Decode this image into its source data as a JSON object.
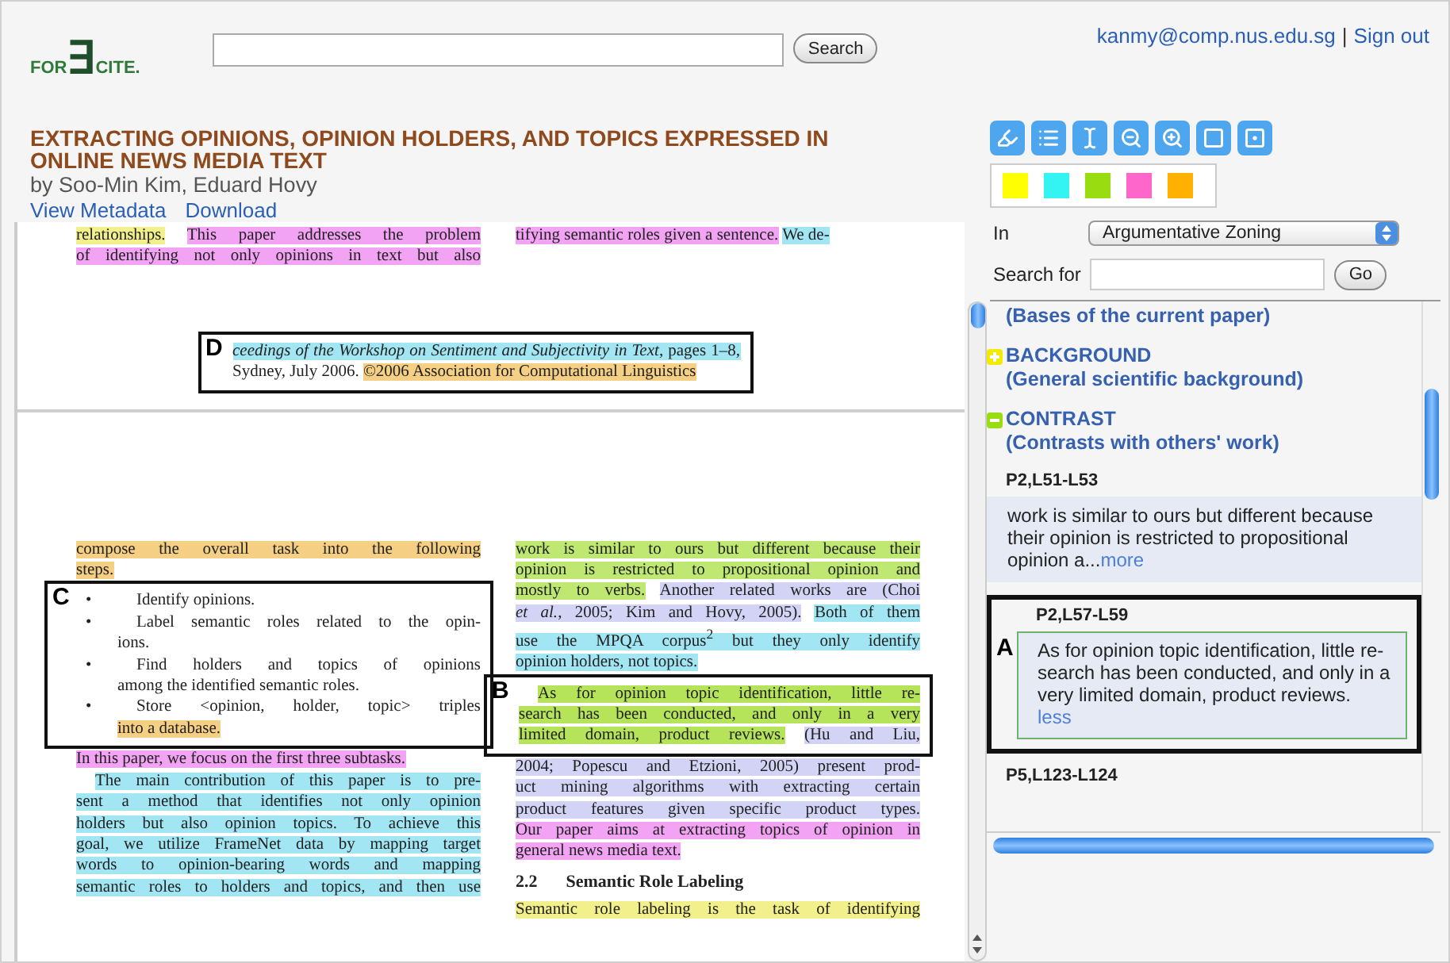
{
  "header": {
    "logo": [
      "FOR",
      "∃",
      "CITE."
    ],
    "search_button": "Search",
    "user": "kanmy@comp.nus.edu.sg",
    "separator": "|",
    "sign_out": "Sign out"
  },
  "paper": {
    "title": "EXTRACTING OPINIONS, OPINION HOLDERS, AND TOPICS EXPRESSED IN ONLINE NEWS MEDIA TEXT",
    "authors": "by Soo-Min Kim, Eduard Hovy",
    "links": [
      "View Metadata",
      "Download"
    ]
  },
  "document": {
    "page_1": {
      "left": [
        {
          "kind": "line",
          "segments": [
            {
              "text": "relationships.",
              "color": "#f2f08c"
            },
            {
              "text": "This paper addresses the problem",
              "color": "#f3a3f3"
            }
          ]
        },
        {
          "kind": "line",
          "segments": [
            {
              "text": "of identifying not only opinions in text but also",
              "color": "#f3a3f3"
            }
          ]
        }
      ],
      "right": [
        {
          "kind": "line",
          "end": true,
          "segments": [
            {
              "text": "tifying semantic roles given a sentence.",
              "color": "#f3a3f3"
            },
            {
              "text": "We de-",
              "color": "#a3e6f3"
            }
          ]
        }
      ],
      "footnote": {
        "label": "D",
        "lines": [
          {
            "segments": [
              {
                "text": "*ceedings of the Workshop on Sentiment and Subjectivity in Text*, pages 1–8,",
                "color": "#a3e6f3"
              }
            ]
          },
          {
            "end": true,
            "segments": [
              {
                "text": "Sydney, July 2006. "
              },
              {
                "text": "©2006 Association for Computational Linguistics",
                "color": "#f5cf83"
              }
            ]
          }
        ]
      }
    },
    "page_2": {
      "left": [
        {
          "kind": "line",
          "segments": [
            {
              "text": "compose the overall task into the following",
              "color": "#f5cf83"
            }
          ]
        },
        {
          "kind": "line",
          "segments": [
            {
              "text": "steps.",
              "color": "#f5cf83"
            }
          ]
        },
        {
          "kind": "callout",
          "label": "C",
          "blocks": [
            {
              "kind": "bullet",
              "bullet": "•",
              "lines": [
                {
                  "end": true,
                  "segments": [
                    {
                      "text": "Identify opinions."
                    }
                  ]
                }
              ]
            },
            {
              "kind": "bullet",
              "bullet": "•",
              "lines": [
                {
                  "segments": [
                    {
                      "text": "Label semantic roles related to the opin-"
                    }
                  ]
                },
                {
                  "segments": [
                    {
                      "text": "ions."
                    }
                  ]
                }
              ]
            },
            {
              "kind": "bullet",
              "bullet": "•",
              "lines": [
                {
                  "segments": [
                    {
                      "text": "Find holders and topics of opinions"
                    }
                  ]
                },
                {
                  "end": true,
                  "segments": [
                    {
                      "text": "among the identified semantic roles."
                    }
                  ]
                }
              ]
            },
            {
              "kind": "bullet",
              "bullet": "•",
              "lines": [
                {
                  "segments": [
                    {
                      "text": "Store <opinion, holder, topic> triples"
                    }
                  ]
                },
                {
                  "end": true,
                  "segments": [
                    {
                      "text": "into a database.",
                      "color": "#f5cf83"
                    }
                  ]
                }
              ]
            }
          ]
        },
        {
          "kind": "line",
          "end": true,
          "segments": [
            {
              "text": "In this paper, we focus on the first three subtasks.",
              "color": "#f3a3f3"
            }
          ]
        },
        {
          "kind": "line",
          "indent": true,
          "segments": [
            {
              "text": "The main contribution of this paper is to pre-",
              "color": "#a3e6f3"
            }
          ]
        },
        {
          "kind": "line",
          "segments": [
            {
              "text": "sent a method that identifies not only opinion",
              "color": "#a3e6f3"
            }
          ]
        },
        {
          "kind": "line",
          "segments": [
            {
              "text": "holders but also opinion topics. To achieve this",
              "color": "#a3e6f3"
            }
          ]
        },
        {
          "kind": "line",
          "segments": [
            {
              "text": "goal, we utilize FrameNet data by mapping target",
              "color": "#a3e6f3"
            }
          ]
        },
        {
          "kind": "line",
          "segments": [
            {
              "text": "words to opinion-bearing words and mapping",
              "color": "#a3e6f3"
            }
          ]
        },
        {
          "kind": "line",
          "segments": [
            {
              "text": "semantic roles to holders and topics, and then use",
              "color": "#a3e6f3"
            }
          ]
        }
      ],
      "right": [
        {
          "kind": "line",
          "segments": [
            {
              "text": "work is similar to ours but different because their",
              "color": "#bfe873"
            }
          ]
        },
        {
          "kind": "line",
          "segments": [
            {
              "text": "opinion is restricted to propositional opinion and",
              "color": "#bfe873"
            }
          ]
        },
        {
          "kind": "line",
          "segments": [
            {
              "text": "mostly to verbs.",
              "color": "#bfe873"
            },
            {
              "text": "Another related works are (Choi",
              "color": "#d3d3f5"
            }
          ]
        },
        {
          "kind": "line",
          "segments": [
            {
              "text": "*et al.*, 2005; Kim and Hovy, 2005).",
              "color": "#d3d3f5"
            },
            {
              "text": "Both of them",
              "color": "#a3e6f3"
            }
          ]
        },
        {
          "kind": "line",
          "segments": [
            {
              "text": "use the MPQA corpus$^{2}$ but they only identify",
              "color": "#a3e6f3"
            }
          ]
        },
        {
          "kind": "line",
          "end": true,
          "segments": [
            {
              "text": "opinion holders, not topics.",
              "color": "#a3e6f3"
            }
          ]
        },
        {
          "kind": "callout",
          "label": "B",
          "blocks": [
            {
              "kind": "line",
              "indent": true,
              "segments": [
                {
                  "text": "As for opinion topic identification, little re-",
                  "color": "#b5e35a"
                }
              ]
            },
            {
              "kind": "line",
              "segments": [
                {
                  "text": "search has been conducted, and only in a very",
                  "color": "#b5e35a"
                }
              ]
            },
            {
              "kind": "line",
              "segments": [
                {
                  "text": "limited domain, product reviews.",
                  "color": "#b5e35a"
                },
                {
                  "text": "(Hu and Liu,",
                  "color": "#d3d3f5"
                }
              ]
            }
          ]
        },
        {
          "kind": "line",
          "segments": [
            {
              "text": "2004; Popescu and Etzioni, 2005) present prod-",
              "color": "#d3d3f5"
            }
          ]
        },
        {
          "kind": "line",
          "segments": [
            {
              "text": "uct mining algorithms with extracting certain",
              "color": "#d3d3f5"
            }
          ]
        },
        {
          "kind": "line",
          "segments": [
            {
              "text": "product features given specific product types.",
              "color": "#d3d3f5"
            }
          ]
        },
        {
          "kind": "line",
          "segments": [
            {
              "text": "Our paper aims at extracting topics of opinion in",
              "color": "#f3a3f3"
            }
          ]
        },
        {
          "kind": "line",
          "end": true,
          "segments": [
            {
              "text": "general news media text.",
              "color": "#f3a3f3"
            }
          ]
        },
        {
          "kind": "heading",
          "number": "2.2",
          "text": "Semantic Role Labeling"
        },
        {
          "kind": "line",
          "segments": [
            {
              "text": "Semantic role labeling is the task of identifying",
              "color": "#f2f08c"
            }
          ]
        }
      ]
    }
  },
  "panel": {
    "swatches": [
      {
        "color": "#ffff00"
      },
      {
        "color": "#33f3f3"
      },
      {
        "color": "#99dd11"
      },
      {
        "color": "#ff66cc"
      },
      {
        "color": "#ffb000"
      }
    ],
    "in_label": "In",
    "scheme": "Argumentative Zoning",
    "search_label": "Search for",
    "go_button": "Go",
    "zones": [
      {
        "description": "(Bases of the current paper)"
      },
      {
        "name": "BACKGROUND",
        "description": "(General scientific background)",
        "color": "#f2ea00",
        "expanded": false
      },
      {
        "name": "CONTRAST",
        "description": "(Contrasts with others' work)",
        "color": "#99dd11",
        "expanded": true
      }
    ],
    "snippets": [
      {
        "location": "P2,L51-L53",
        "text": "work is similar to ours but different because their opinion is restricted to propositional opinion a...",
        "link": "more",
        "expanded": false
      },
      {
        "location": "P2,L57-L59",
        "text": "As for opinion topic identification, little re-search has been conducted, and only in a very limited domain, product reviews.",
        "link": "less",
        "expanded": true,
        "callout": "A"
      },
      {
        "location": "P5,L123-L124"
      }
    ]
  }
}
